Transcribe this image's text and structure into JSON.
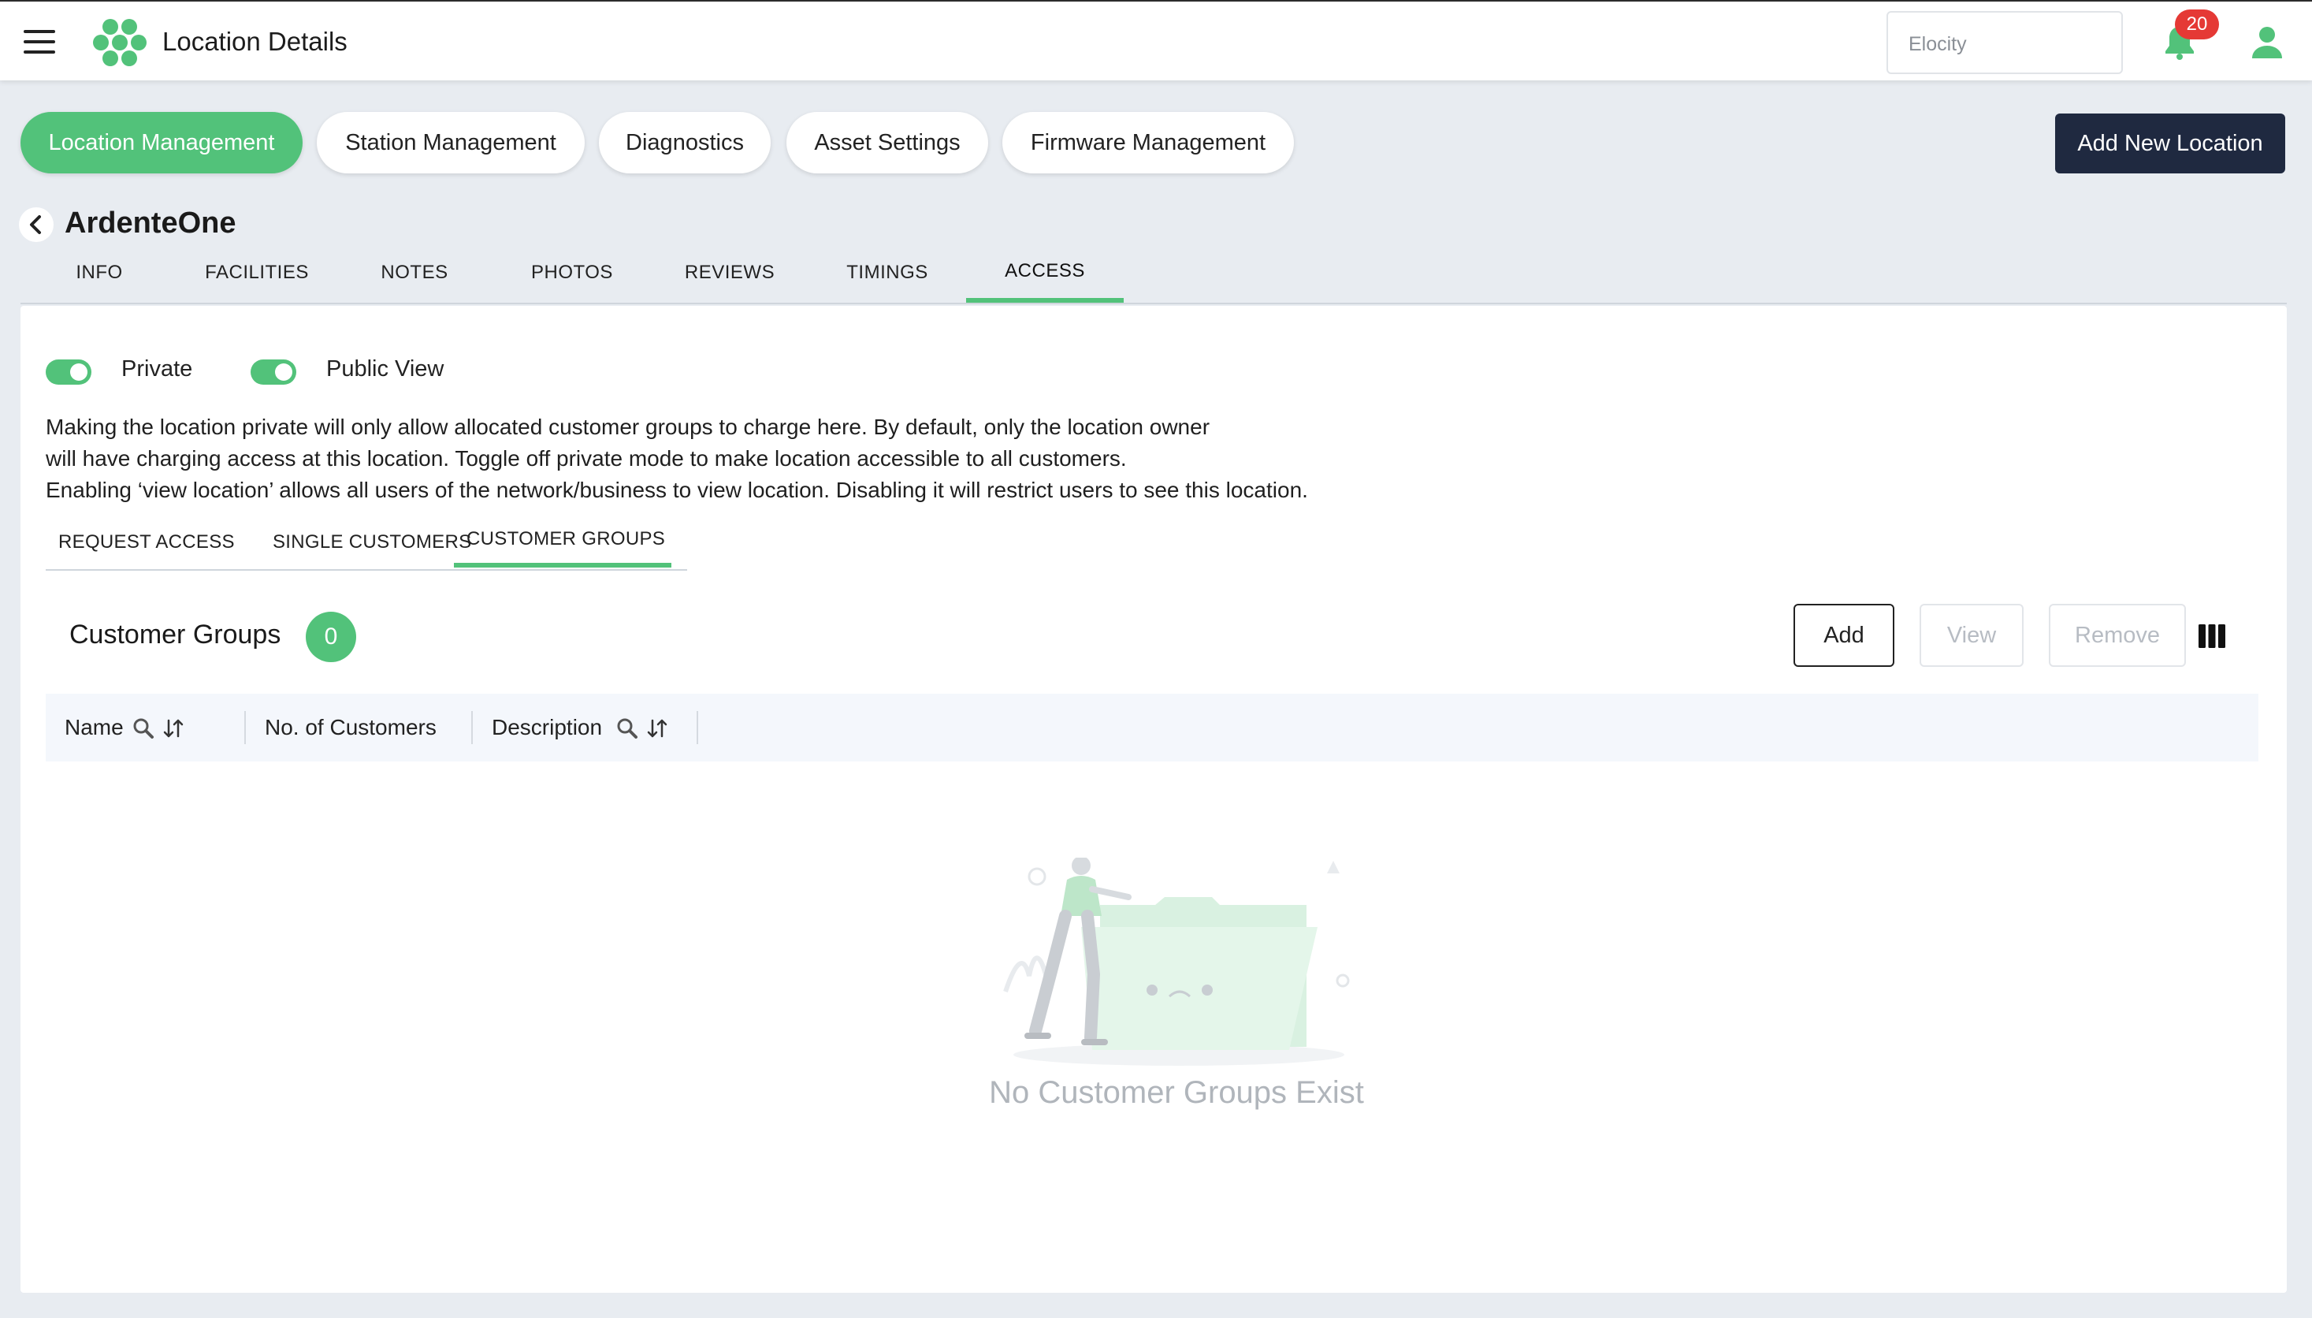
{
  "header": {
    "title": "Location Details",
    "tenant_placeholder": "Elocity",
    "notification_count": "20",
    "brand_color": "#52c27a"
  },
  "modules": [
    {
      "label": "Location Management",
      "active": true
    },
    {
      "label": "Station Management",
      "active": false
    },
    {
      "label": "Diagnostics",
      "active": false
    },
    {
      "label": "Asset Settings",
      "active": false
    },
    {
      "label": "Firmware Management",
      "active": false
    }
  ],
  "add_location_label": "Add New Location",
  "location": {
    "name": "ArdenteOne",
    "tabs": [
      "INFO",
      "FACILITIES",
      "NOTES",
      "PHOTOS",
      "REVIEWS",
      "TIMINGS",
      "ACCESS"
    ],
    "active_tab": "ACCESS"
  },
  "access": {
    "toggles": [
      {
        "label": "Private",
        "on": true
      },
      {
        "label": "Public View",
        "on": true
      }
    ],
    "description_lines": [
      "Making the location private will only allow allocated customer groups to charge here. By default, only the location owner",
      "will have charging access at this location. Toggle off private mode to make location accessible to all customers.",
      "Enabling ‘view location’ allows all users of the network/business to view location. Disabling it will restrict users to see this location."
    ],
    "tabs": [
      "REQUEST ACCESS",
      "SINGLE CUSTOMERS",
      "CUSTOMER GROUPS"
    ],
    "active_tab": "CUSTOMER GROUPS"
  },
  "customer_groups": {
    "title": "Customer Groups",
    "count": "0",
    "buttons": {
      "add": "Add",
      "view": "View",
      "remove": "Remove"
    },
    "columns": [
      "Name",
      "No. of Customers",
      "Description"
    ],
    "empty_message": "No Customer Groups Exist"
  },
  "icons": [
    "menu-icon",
    "logo-icon",
    "bell-icon",
    "user-icon",
    "chevron-left-icon",
    "search-icon",
    "sort-icon",
    "columns-icon"
  ]
}
